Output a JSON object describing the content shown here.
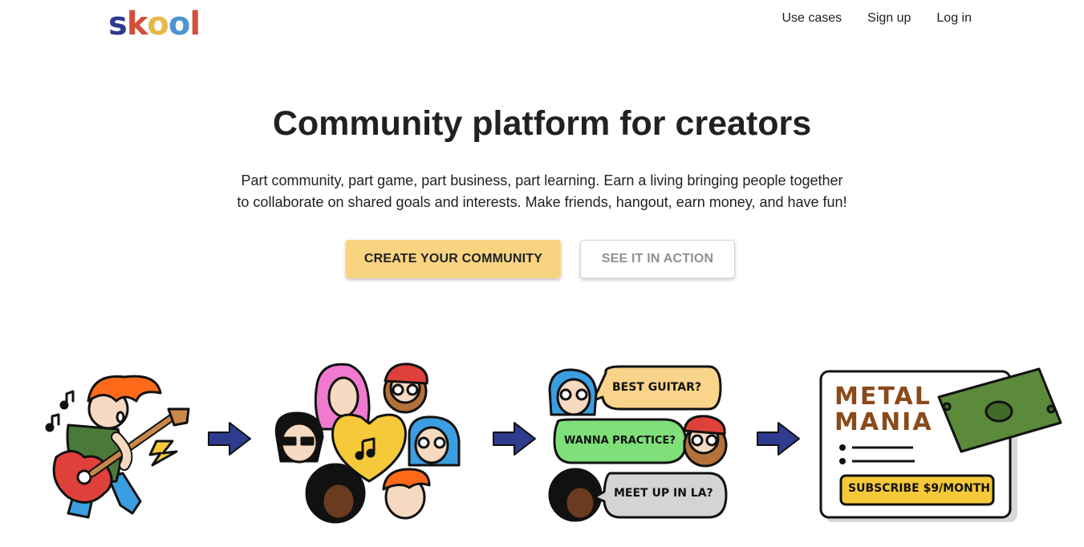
{
  "brand": {
    "letters": [
      {
        "char": "s",
        "color": "#2e3b8e"
      },
      {
        "char": "k",
        "color": "#d34e3b"
      },
      {
        "char": "o",
        "color": "#e8b84a"
      },
      {
        "char": "o",
        "color": "#4c95d1"
      },
      {
        "char": "l",
        "color": "#d34e3b"
      }
    ]
  },
  "nav": {
    "use_cases": "Use cases",
    "sign_up": "Sign up",
    "log_in": "Log in"
  },
  "hero": {
    "title": "Community platform for creators",
    "subtitle_line1": "Part community, part game, part business, part learning. Earn a living bringing people together",
    "subtitle_line2": "to collaborate on shared goals and interests. Make friends, hangout, earn money, and have fun!",
    "primary_button": "CREATE YOUR COMMUNITY",
    "secondary_button": "SEE IT IN ACTION"
  },
  "illustrations": {
    "chat": {
      "bubble1": "BEST GUITAR?",
      "bubble2": "WANNA PRACTICE?",
      "bubble3": "MEET UP IN LA?"
    },
    "card": {
      "title_line1": "METAL",
      "title_line2": "MANIA",
      "subscribe": "SUBSCRIBE $9/MONTH"
    }
  },
  "colors": {
    "primary_button": "#f8d481",
    "arrow": "#2e3b8e",
    "text": "#202124"
  }
}
